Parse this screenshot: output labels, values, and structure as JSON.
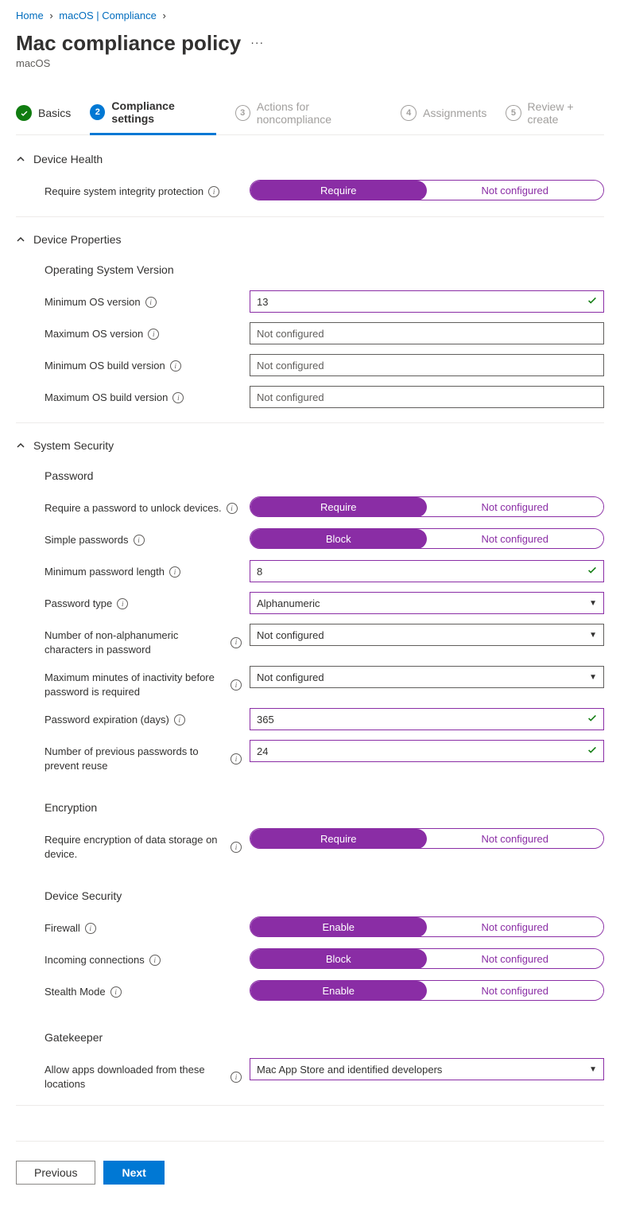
{
  "breadcrumb": {
    "home": "Home",
    "mid": "macOS | Compliance"
  },
  "header": {
    "title": "Mac compliance policy",
    "subtitle": "macOS"
  },
  "tabs": {
    "basics": "Basics",
    "compliance": "Compliance settings",
    "actions": "Actions for noncompliance",
    "assignments": "Assignments",
    "review": "Review + create",
    "n2": "2",
    "n3": "3",
    "n4": "4",
    "n5": "5"
  },
  "sections": {
    "device_health": {
      "title": "Device Health",
      "require_sip": {
        "label": "Require system integrity protection",
        "left": "Require",
        "right": "Not configured"
      }
    },
    "device_properties": {
      "title": "Device Properties",
      "os_version": "Operating System Version",
      "min_os": {
        "label": "Minimum OS version",
        "value": "13"
      },
      "max_os": {
        "label": "Maximum OS version",
        "placeholder": "Not configured"
      },
      "min_build": {
        "label": "Minimum OS build version",
        "placeholder": "Not configured"
      },
      "max_build": {
        "label": "Maximum OS build version",
        "placeholder": "Not configured"
      }
    },
    "system_security": {
      "title": "System Security",
      "password_head": "Password",
      "require_pwd": {
        "label": "Require a password to unlock devices.",
        "left": "Require",
        "right": "Not configured"
      },
      "simple_pwd": {
        "label": "Simple passwords",
        "left": "Block",
        "right": "Not configured"
      },
      "min_len": {
        "label": "Minimum password length",
        "value": "8"
      },
      "pwd_type": {
        "label": "Password type",
        "value": "Alphanumeric"
      },
      "nonalpha": {
        "label": "Number of non-alphanumeric characters in password",
        "value": "Not configured"
      },
      "max_inactive": {
        "label": "Maximum minutes of inactivity before password is required",
        "value": "Not configured"
      },
      "expiration": {
        "label": "Password expiration (days)",
        "value": "365"
      },
      "prev_pwd": {
        "label": "Number of previous passwords to prevent reuse",
        "value": "24"
      },
      "encryption_head": "Encryption",
      "require_enc": {
        "label": "Require encryption of data storage on device.",
        "left": "Require",
        "right": "Not configured"
      },
      "devsec_head": "Device Security",
      "firewall": {
        "label": "Firewall",
        "left": "Enable",
        "right": "Not configured"
      },
      "incoming": {
        "label": "Incoming connections",
        "left": "Block",
        "right": "Not configured"
      },
      "stealth": {
        "label": "Stealth Mode",
        "left": "Enable",
        "right": "Not configured"
      },
      "gatekeeper_head": "Gatekeeper",
      "allow_apps": {
        "label": "Allow apps downloaded from these locations",
        "value": "Mac App Store and identified developers"
      }
    }
  },
  "footer": {
    "previous": "Previous",
    "next": "Next"
  }
}
